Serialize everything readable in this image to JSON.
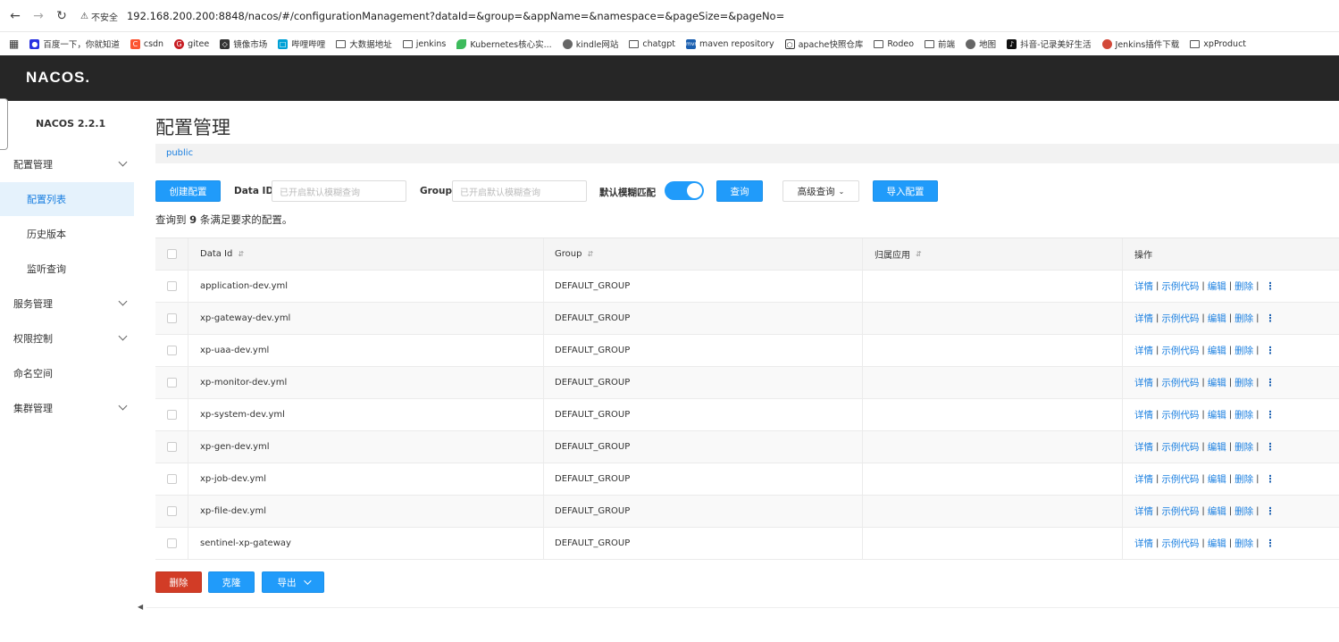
{
  "browser": {
    "security_label": "不安全",
    "url": "192.168.200.200:8848/nacos/#/configurationManagement?dataId=&group=&appName=&namespace=&pageSize=&pageNo=",
    "bookmarks": [
      "百度一下，你就知道",
      "csdn",
      "gitee",
      "镜像市场",
      "哔哩哔哩",
      "大数据地址",
      "jenkins",
      "Kubernetes核心实...",
      "kindle网站",
      "chatgpt",
      "maven repository",
      "apache快照仓库",
      "Rodeo",
      "前端",
      "地图",
      "抖音-记录美好生活",
      "Jenkins插件下载",
      "xpProduct"
    ]
  },
  "header": {
    "logo": "NACOS."
  },
  "sidebar": {
    "version": "NACOS 2.2.1",
    "items": [
      {
        "label": "配置管理"
      },
      {
        "label": "配置列表"
      },
      {
        "label": "历史版本"
      },
      {
        "label": "监听查询"
      },
      {
        "label": "服务管理"
      },
      {
        "label": "权限控制"
      },
      {
        "label": "命名空间"
      },
      {
        "label": "集群管理"
      }
    ]
  },
  "main": {
    "title": "配置管理",
    "namespace": "public",
    "toolbar": {
      "create_label": "创建配置",
      "dataid_label": "Data ID",
      "dataid_placeholder": "已开启默认模糊查询",
      "group_label": "Group",
      "group_placeholder": "已开启默认模糊查询",
      "fuzzy_label": "默认模糊匹配",
      "query_label": "查询",
      "advanced_label": "高级查询",
      "import_label": "导入配置"
    },
    "result": {
      "prefix": "查询到",
      "count": "9",
      "suffix": "条满足要求的配置。"
    },
    "table": {
      "headers": {
        "data_id": "Data Id",
        "group": "Group",
        "app": "归属应用",
        "ops": "操作"
      },
      "ops": {
        "detail": "详情",
        "sample": "示例代码",
        "edit": "编辑",
        "delete": "删除",
        "sep": "|",
        "more": "⋮"
      },
      "rows": [
        {
          "data_id": "application-dev.yml",
          "group": "DEFAULT_GROUP",
          "app": ""
        },
        {
          "data_id": "xp-gateway-dev.yml",
          "group": "DEFAULT_GROUP",
          "app": ""
        },
        {
          "data_id": "xp-uaa-dev.yml",
          "group": "DEFAULT_GROUP",
          "app": ""
        },
        {
          "data_id": "xp-monitor-dev.yml",
          "group": "DEFAULT_GROUP",
          "app": ""
        },
        {
          "data_id": "xp-system-dev.yml",
          "group": "DEFAULT_GROUP",
          "app": ""
        },
        {
          "data_id": "xp-gen-dev.yml",
          "group": "DEFAULT_GROUP",
          "app": ""
        },
        {
          "data_id": "xp-job-dev.yml",
          "group": "DEFAULT_GROUP",
          "app": ""
        },
        {
          "data_id": "xp-file-dev.yml",
          "group": "DEFAULT_GROUP",
          "app": ""
        },
        {
          "data_id": "sentinel-xp-gateway",
          "group": "DEFAULT_GROUP",
          "app": ""
        }
      ]
    },
    "bottom": {
      "delete_label": "删除",
      "clone_label": "克隆",
      "export_label": "导出"
    }
  },
  "colors": {
    "primary": "#209bfa",
    "danger": "#d23c26",
    "header_bg": "#262626",
    "link": "#1a7fe0"
  }
}
